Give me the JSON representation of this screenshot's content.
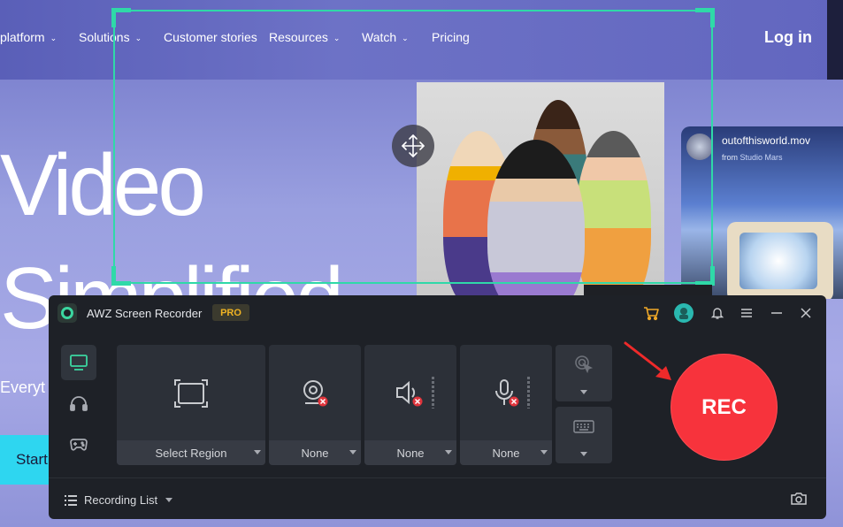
{
  "website": {
    "nav": [
      {
        "label": "platform",
        "has_dropdown": true
      },
      {
        "label": "Solutions",
        "has_dropdown": true
      },
      {
        "label": "Customer stories",
        "has_dropdown": false
      },
      {
        "label": "Resources",
        "has_dropdown": true
      },
      {
        "label": "Watch",
        "has_dropdown": true
      },
      {
        "label": "Pricing",
        "has_dropdown": false
      }
    ],
    "login_label": "Log in",
    "hero_line1": "Video",
    "hero_line2": "Simplified",
    "hero_sub": "Everyt",
    "start_label": "Start",
    "tv_card": {
      "title": "outofthisworld.mov",
      "from_prefix": "from",
      "from_name": "Studio Mars"
    }
  },
  "recorder": {
    "app_title": "AWZ Screen Recorder",
    "pro_badge": "PRO",
    "titlebar_icons": [
      "cart-icon",
      "avatar-icon",
      "bell-icon",
      "menu-icon",
      "minimize-icon",
      "close-icon"
    ],
    "modes": [
      {
        "name": "screen-mode",
        "icon": "monitor-icon",
        "active": true
      },
      {
        "name": "audio-mode",
        "icon": "headphones-icon",
        "active": false
      },
      {
        "name": "game-mode",
        "icon": "gamepad-icon",
        "active": false
      }
    ],
    "panels": {
      "region": {
        "label": "Select Region",
        "icon": "region-icon"
      },
      "webcam": {
        "label": "None",
        "icon": "webcam-icon"
      },
      "system_audio": {
        "label": "None",
        "icon": "speaker-icon"
      },
      "microphone": {
        "label": "None",
        "icon": "microphone-icon"
      }
    },
    "rec_label": "REC",
    "recording_list_label": "Recording List",
    "colors": {
      "accent": "#2fd9a8",
      "rec_red": "#f7333c",
      "pro_gold": "#f0b323",
      "panel_bg": "#2c3038",
      "window_bg": "#1e2127"
    }
  }
}
